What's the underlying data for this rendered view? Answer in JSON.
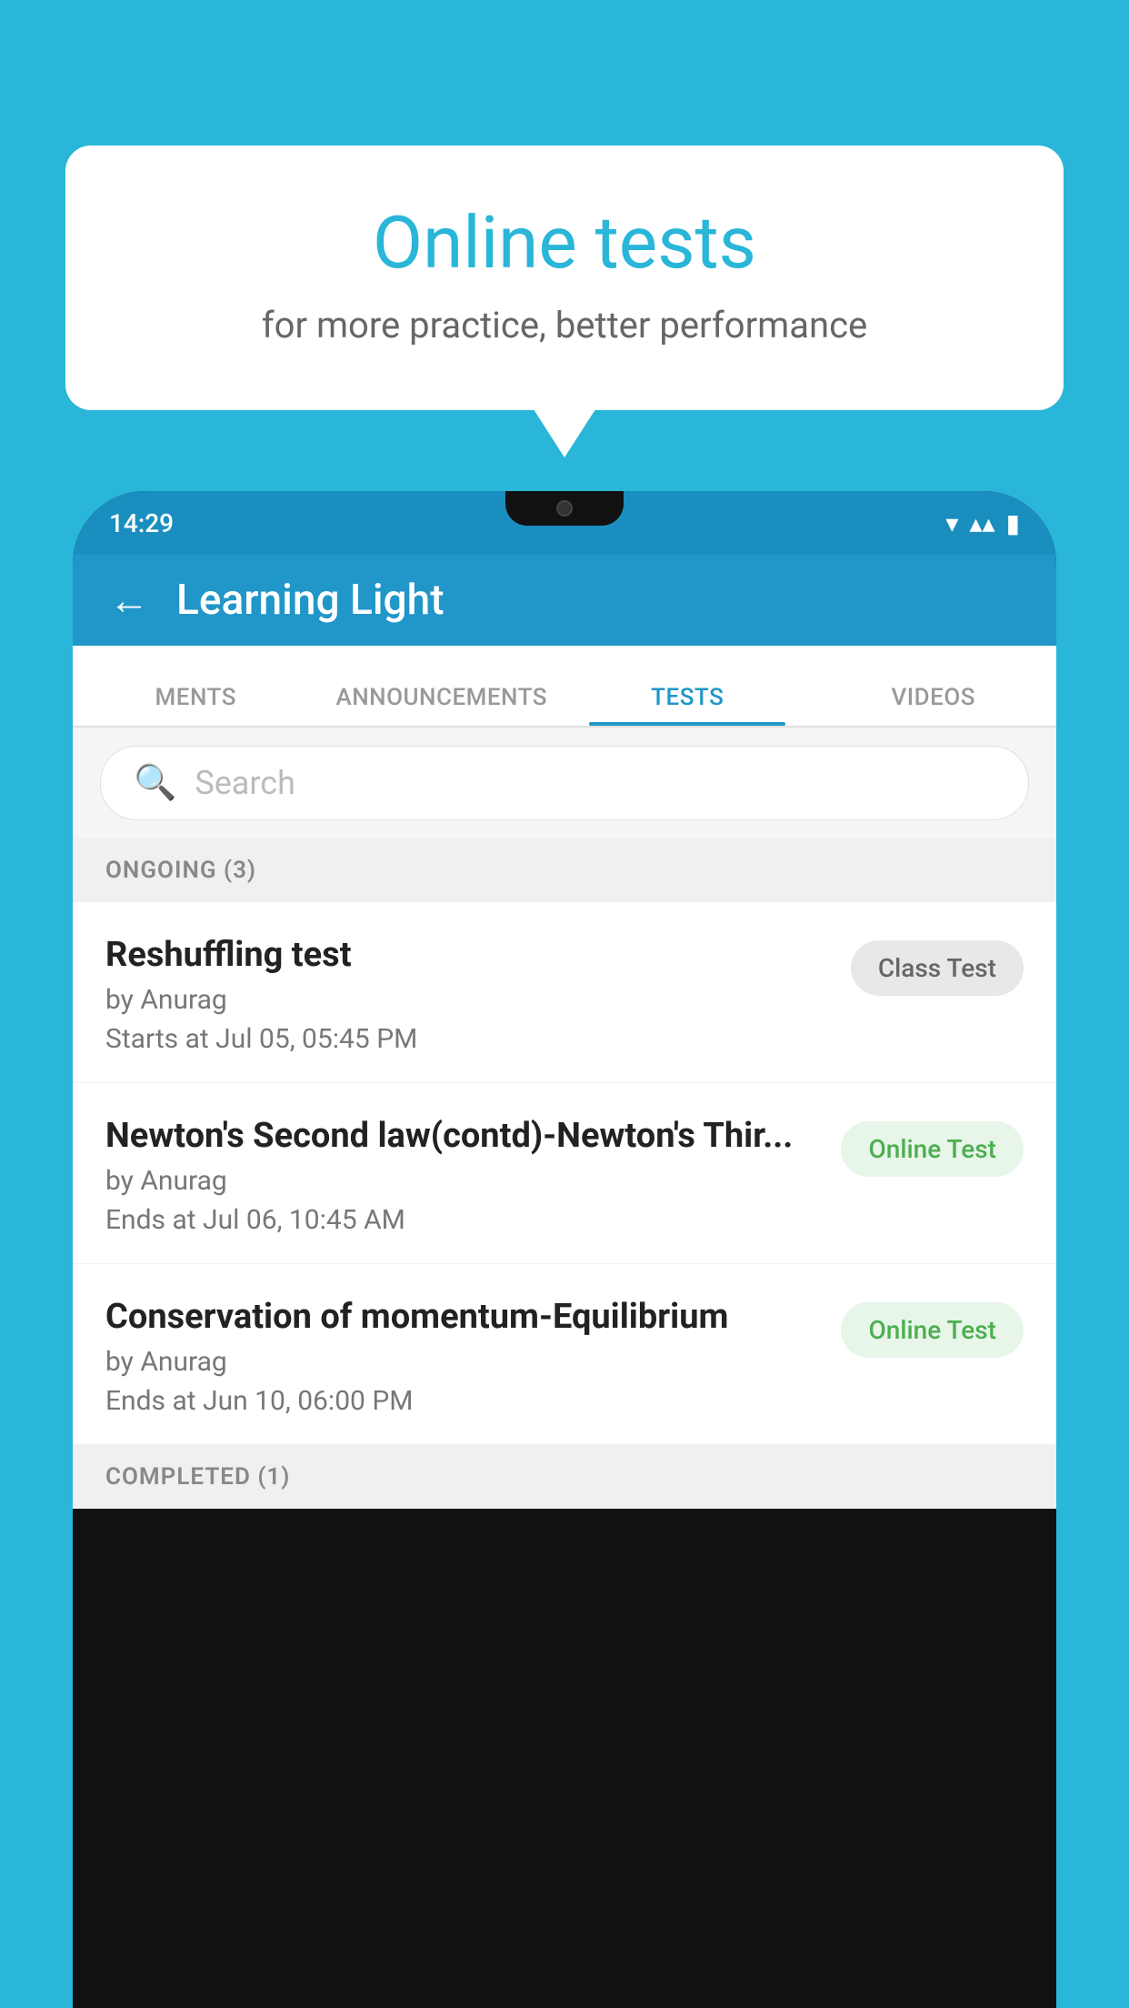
{
  "background": {
    "color": "#29b6d8"
  },
  "speech_bubble": {
    "title": "Online tests",
    "subtitle": "for more practice, better performance"
  },
  "status_bar": {
    "time": "14:29",
    "wifi_icon": "▾",
    "signal_icon": "▴▴",
    "battery_icon": "▮"
  },
  "app_bar": {
    "back_label": "←",
    "title": "Learning Light"
  },
  "tabs": [
    {
      "label": "MENTS",
      "active": false
    },
    {
      "label": "ANNOUNCEMENTS",
      "active": false
    },
    {
      "label": "TESTS",
      "active": true
    },
    {
      "label": "VIDEOS",
      "active": false
    }
  ],
  "search": {
    "placeholder": "Search"
  },
  "ongoing_section": {
    "label": "ONGOING (3)"
  },
  "tests": [
    {
      "title": "Reshuffling test",
      "by": "by Anurag",
      "date": "Starts at  Jul 05, 05:45 PM",
      "badge": "Class Test",
      "badge_type": "class"
    },
    {
      "title": "Newton's Second law(contd)-Newton's Thir...",
      "by": "by Anurag",
      "date": "Ends at  Jul 06, 10:45 AM",
      "badge": "Online Test",
      "badge_type": "online"
    },
    {
      "title": "Conservation of momentum-Equilibrium",
      "by": "by Anurag",
      "date": "Ends at  Jun 10, 06:00 PM",
      "badge": "Online Test",
      "badge_type": "online"
    }
  ],
  "completed_section": {
    "label": "COMPLETED (1)"
  }
}
